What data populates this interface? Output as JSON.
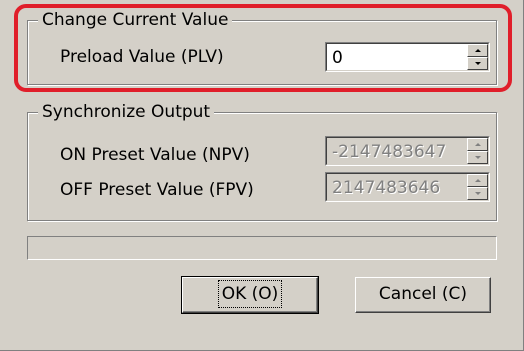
{
  "colors": {
    "face": "#d4d0c8",
    "shadow": "#808080",
    "highlight_ring": "#e01e2a"
  },
  "change_group": {
    "legend": "Change Current Value",
    "plv_label": "Preload Value (PLV)",
    "plv_value": "0"
  },
  "sync_group": {
    "legend": "Synchronize Output",
    "npv_label": "ON Preset Value (NPV)",
    "npv_value": "-2147483647",
    "fpv_label": "OFF Preset Value (FPV)",
    "fpv_value": "2147483646"
  },
  "status_text": "",
  "buttons": {
    "ok": "OK (O)",
    "cancel": "Cancel (C)"
  },
  "icons": {
    "spin_up": "triangle-up-icon",
    "spin_down": "triangle-down-icon"
  }
}
